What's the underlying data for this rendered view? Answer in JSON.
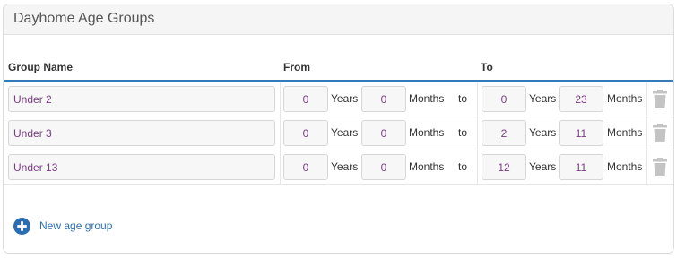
{
  "panel": {
    "title": "Dayhome Age Groups"
  },
  "columns": {
    "group_name": "Group Name",
    "from": "From",
    "to": "To"
  },
  "units": {
    "years": "Years",
    "months": "Months",
    "to": "to"
  },
  "rows": [
    {
      "name": "Under 2",
      "from_years": "0",
      "from_months": "0",
      "to_years": "0",
      "to_months": "23"
    },
    {
      "name": "Under 3",
      "from_years": "0",
      "from_months": "0",
      "to_years": "2",
      "to_months": "11"
    },
    {
      "name": "Under 13",
      "from_years": "0",
      "from_months": "0",
      "to_years": "12",
      "to_months": "11"
    }
  ],
  "actions": {
    "new_age_group": "New age group"
  },
  "icons": {
    "delete": "trash-icon",
    "add": "plus-circle-icon"
  },
  "colors": {
    "accent": "#337ab7",
    "link": "#2a6db3",
    "input_text": "#7a3b85",
    "trash": "#c4c4c4"
  }
}
